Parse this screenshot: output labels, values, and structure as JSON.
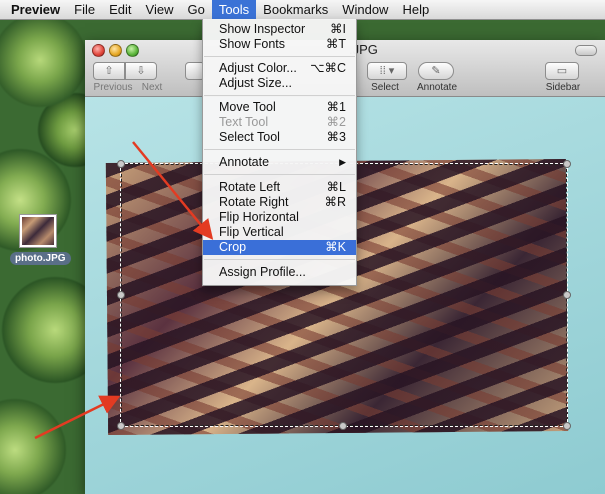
{
  "menubar": {
    "app": "Preview",
    "items": [
      "File",
      "Edit",
      "View",
      "Go",
      "Tools",
      "Bookmarks",
      "Window",
      "Help"
    ]
  },
  "desktop": {
    "file_label": "photo.JPG"
  },
  "window": {
    "title": ".JPG",
    "toolbar": {
      "previous_label": "Previous",
      "next_label": "Next",
      "select_label": "Select",
      "annotate_label": "Annotate",
      "sidebar_label": "Sidebar"
    }
  },
  "tools_menu": {
    "items": [
      {
        "label": "Show Inspector",
        "shortcut": "⌘I"
      },
      {
        "label": "Show Fonts",
        "shortcut": "⌘T"
      },
      {
        "label": "Adjust Color...",
        "shortcut": "⌥⌘C"
      },
      {
        "label": "Adjust Size...",
        "shortcut": ""
      },
      {
        "label": "Move Tool",
        "shortcut": "⌘1"
      },
      {
        "label": "Text Tool",
        "shortcut": "⌘2",
        "disabled": true
      },
      {
        "label": "Select Tool",
        "shortcut": "⌘3"
      },
      {
        "label": "Annotate",
        "shortcut": "▶"
      },
      {
        "label": "Rotate Left",
        "shortcut": "⌘L"
      },
      {
        "label": "Rotate Right",
        "shortcut": "⌘R"
      },
      {
        "label": "Flip Horizontal",
        "shortcut": ""
      },
      {
        "label": "Flip Vertical",
        "shortcut": ""
      },
      {
        "label": "Crop",
        "shortcut": "⌘K",
        "highlighted": true
      },
      {
        "label": "Assign Profile...",
        "shortcut": ""
      }
    ]
  },
  "colors": {
    "menu_highlight": "#3a6fd8",
    "arrow": "#e33b22"
  }
}
